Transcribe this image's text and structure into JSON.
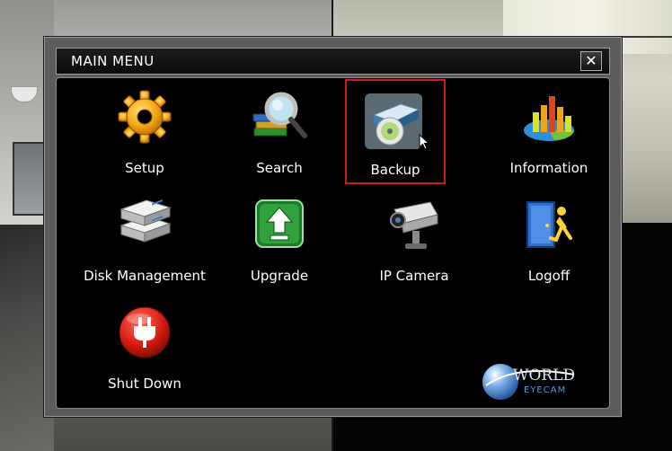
{
  "dialog": {
    "title": "MAIN MENU",
    "close_glyph": "✕"
  },
  "menu": {
    "selected": "Backup",
    "items": [
      {
        "label": "Setup",
        "icon": "gear-icon"
      },
      {
        "label": "Search",
        "icon": "magnifier-books-icon"
      },
      {
        "label": "Backup",
        "icon": "disc-drive-icon"
      },
      {
        "label": "Information",
        "icon": "bar-pie-chart-icon"
      },
      {
        "label": "Disk Management",
        "icon": "hard-disk-icon"
      },
      {
        "label": "Upgrade",
        "icon": "upload-arrow-icon"
      },
      {
        "label": "IP Camera",
        "icon": "security-camera-icon"
      },
      {
        "label": "Logoff",
        "icon": "exit-door-icon"
      },
      {
        "label": "Shut Down",
        "icon": "power-plug-icon"
      }
    ]
  },
  "logo": {
    "line1": "WORLD",
    "line2": "EYECAM"
  },
  "colors": {
    "selection": "#d11919",
    "panel": "#000000",
    "frame": "#5c5c5c"
  }
}
